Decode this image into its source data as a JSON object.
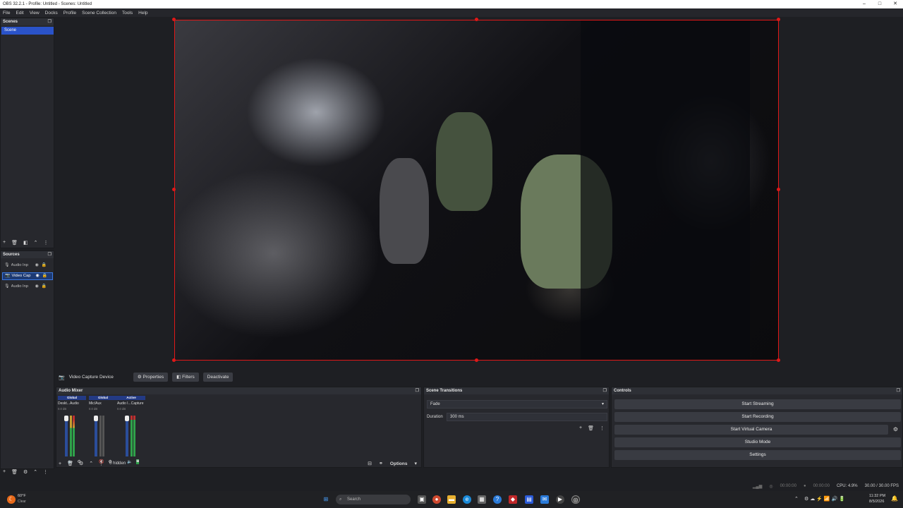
{
  "window": {
    "title": "OBS 32.2.1 - Profile: Untitled - Scenes: Untitled",
    "minimize": "–",
    "maximize": "□",
    "close": "✕"
  },
  "menu": [
    "File",
    "Edit",
    "View",
    "Docks",
    "Profile",
    "Scene Collection",
    "Tools",
    "Help"
  ],
  "scenes": {
    "title": "Scenes",
    "items": [
      "Scene"
    ]
  },
  "sources": {
    "title": "Sources",
    "items": [
      {
        "name": "Audio Inp",
        "selected": false
      },
      {
        "name": "Video Cap",
        "selected": true
      },
      {
        "name": "Audio Inp",
        "selected": false
      }
    ]
  },
  "source_toolbar": {
    "source_name": "Video Capture Device",
    "properties": "Properties",
    "filters": "Filters",
    "deactivate": "Deactivate"
  },
  "audio_mixer": {
    "title": "Audio Mixer",
    "channels": [
      {
        "status": "Global",
        "name": "Deskt...Audio",
        "db": "0.0 dB"
      },
      {
        "status": "Global",
        "name": "Mic/Aux",
        "db": "0.0 dB"
      },
      {
        "status": "Active",
        "name": "Audio I...Capture",
        "db": "0.0 dB"
      }
    ],
    "hidden": "0 hidden",
    "options": "Options"
  },
  "scene_transitions": {
    "title": "Scene Transitions",
    "transition": "Fade",
    "duration_label": "Duration",
    "duration_value": "300 ms"
  },
  "controls": {
    "title": "Controls",
    "start_streaming": "Start Streaming",
    "start_recording": "Start Recording",
    "start_virtual_camera": "Start Virtual Camera",
    "studio_mode": "Studio Mode",
    "settings": "Settings"
  },
  "status_bar": {
    "stream_time": "00:00:00",
    "rec_time": "00:00:00",
    "cpu": "CPU: 4.9%",
    "fps": "30.00 / 30.00 FPS"
  },
  "taskbar": {
    "weather_temp": "60°F",
    "weather_desc": "Clear",
    "search": "Search",
    "time": "11:32 PM",
    "date": "8/5/2026"
  },
  "colors": {
    "accent": "#2a53c9",
    "selection_border": "#e01818"
  }
}
